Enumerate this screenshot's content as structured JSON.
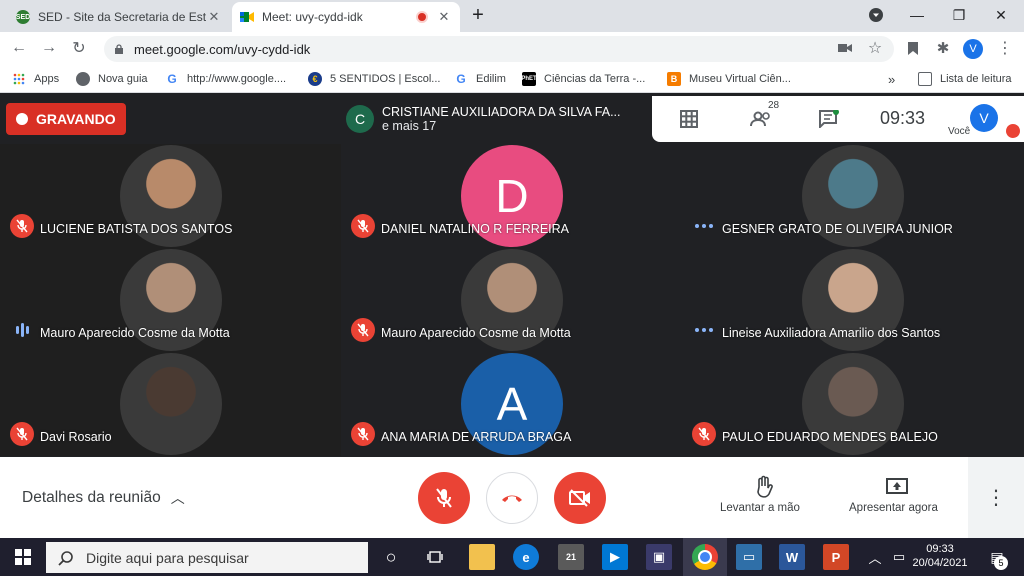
{
  "browser": {
    "tabs": [
      {
        "title": "SED - Site da Secretaria de Estado",
        "favicon": "SED",
        "active": false
      },
      {
        "title": "Meet: uvy-cydd-idk",
        "favicon": "meet",
        "active": true,
        "recording": true
      }
    ],
    "address": "meet.google.com/uvy-cydd-idk",
    "profile_initial": "V",
    "bookmarks": [
      {
        "label": "Apps"
      },
      {
        "label": "Nova guia"
      },
      {
        "label": "http://www.google...."
      },
      {
        "label": "5 SENTIDOS | Escol..."
      },
      {
        "label": "Edilim"
      },
      {
        "label": "Ciências da Terra -..."
      },
      {
        "label": "Museu Virtual Ciên..."
      }
    ],
    "more": "»",
    "reading_list": "Lista de leitura"
  },
  "meet": {
    "recording_label": "GRAVANDO",
    "presenter": {
      "initial": "C",
      "name": "CRISTIANE AUXILIADORA DA SILVA FA...",
      "more": "e mais 17"
    },
    "participant_count": "28",
    "clock": "09:33",
    "self_initial": "V",
    "self_label": "Você",
    "participants": [
      {
        "name": "LUCIENE BATISTA DOS SANTOS",
        "status": "muted",
        "avatar": "photo",
        "color": "#b88a6a"
      },
      {
        "name": "DANIEL NATALINO R FERREIRA",
        "status": "muted",
        "avatar": "letter",
        "initial": "D",
        "color": "#e84c80"
      },
      {
        "name": "GESNER GRATO DE OLIVEIRA JUNIOR",
        "status": "dots",
        "avatar": "photo",
        "color": "#4d7a8a"
      },
      {
        "name": "Mauro Aparecido Cosme da Motta",
        "status": "speaking",
        "avatar": "photo",
        "color": "#b08f78"
      },
      {
        "name": "Mauro Aparecido Cosme da Motta",
        "status": "muted",
        "avatar": "photo",
        "color": "#b08f78"
      },
      {
        "name": "Lineise Auxiliadora Amarilio dos Santos",
        "status": "dots",
        "avatar": "photo",
        "color": "#c9a58c"
      },
      {
        "name": "Davi Rosario",
        "status": "muted",
        "avatar": "photo",
        "color": "#4a3a32"
      },
      {
        "name": "ANA MARIA DE ARRUDA BRAGA",
        "status": "muted",
        "avatar": "letter",
        "initial": "A",
        "color": "#1a5fa8"
      },
      {
        "name": "PAULO EDUARDO MENDES BALEJO",
        "status": "muted",
        "avatar": "photo",
        "color": "#6a5a52"
      }
    ],
    "details_label": "Detalhes da reunião",
    "raise_hand_label": "Levantar a mão",
    "present_label": "Apresentar agora"
  },
  "taskbar": {
    "search_placeholder": "Digite aqui para pesquisar",
    "time": "09:33",
    "date": "20/04/2021",
    "notifications": "5"
  },
  "colors": {
    "danger": "#ea4335",
    "accent": "#1a73e8",
    "recording": "#d93025"
  }
}
